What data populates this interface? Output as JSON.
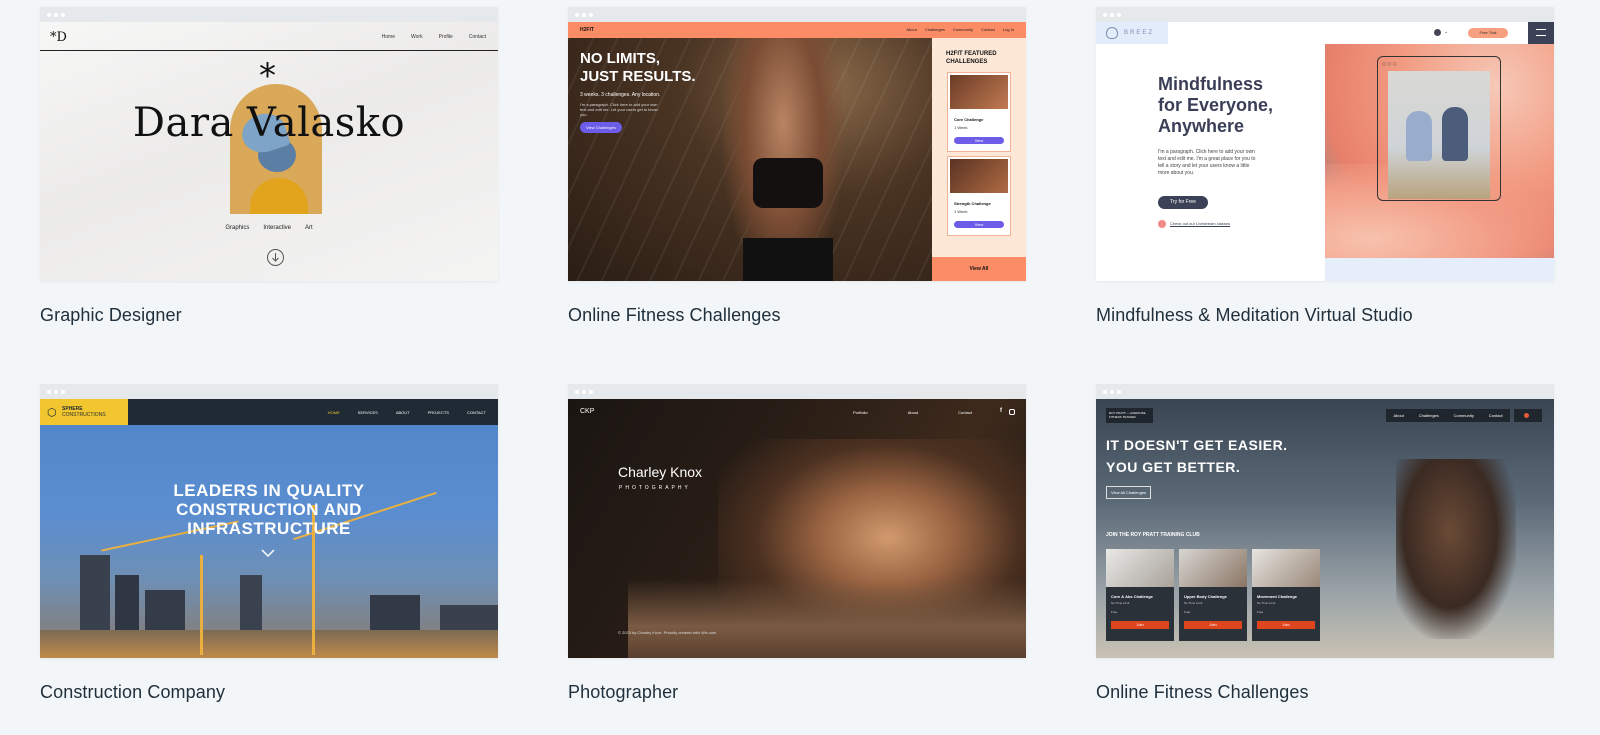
{
  "templates": [
    {
      "caption": "Graphic Designer",
      "logo": "*D",
      "nav": [
        "Home",
        "Work",
        "Profile",
        "Contact"
      ],
      "hero_title": "Dara Valasko",
      "asterisk": "*",
      "tags": [
        "Graphics",
        "Interactive",
        "Art"
      ]
    },
    {
      "caption": "Online Fitness Challenges",
      "logo": "H2FIT",
      "nav": [
        "About",
        "Challenges",
        "Community",
        "Contact",
        "Log In"
      ],
      "headline_1": "NO LIMITS,",
      "headline_2": "JUST RESULTS.",
      "subline": "3 weeks. 3 challenges. Any location.",
      "paragraph": "I'm a paragraph. Click here to add your own text and edit me. Let your users get to know you.",
      "cta": "View Challenges",
      "panel_title": "H2FIT FEATURED CHALLENGES",
      "items": [
        {
          "name": "Core Challenge",
          "duration": "1 Week",
          "button": "View"
        },
        {
          "name": "Strength Challenge",
          "duration": "1 Week",
          "button": "View"
        }
      ],
      "view_all": "View All"
    },
    {
      "caption": "Mindfulness & Meditation Virtual Studio",
      "logo": "BREEZ",
      "free_trial": "Free Trial",
      "heading": "Mindfulness for Everyone, Anywhere",
      "paragraph": "I'm a paragraph. Click here to add your own text and edit me. I'm a great place for you to tell a story and let your users know a little more about you.",
      "cta": "Try for Free",
      "link": "Check out our Livestream classes"
    },
    {
      "caption": "Construction Company",
      "logo_1": "SPHERE",
      "logo_2": "CONSTRUCTIONS",
      "nav": [
        "HOME",
        "SERVICES",
        "ABOUT",
        "PROJECTS",
        "CONTACT"
      ],
      "hero_1": "LEADERS IN QUALITY",
      "hero_2": "CONSTRUCTION AND",
      "hero_3": "INFRASTRUCTURE"
    },
    {
      "caption": "Photographer",
      "logo": "CKP",
      "nav": [
        "Portfolio",
        "About",
        "Contact"
      ],
      "name": "Charley Knox",
      "subtitle": "PHOTOGRAPHY",
      "footer": "© 2023 by Charley Knox. Proudly created with Wix.com"
    },
    {
      "caption": "Online Fitness Challenges",
      "logo": "ROY PRATT — EXERCISE FITNESS TRAINER",
      "nav": [
        "About",
        "Challenges",
        "Community",
        "Contact"
      ],
      "hero_1": "IT DOESN'T GET EASIER.",
      "hero_2": "YOU GET BETTER.",
      "cta": "View All Challenges",
      "club": "JOIN THE ROY PRATT TRAINING CLUB",
      "items": [
        {
          "name": "Core & Abs Challenge",
          "limit": "No Time Limit",
          "price": "Free",
          "button": "Join"
        },
        {
          "name": "Upper Body Challenge",
          "limit": "No Time Limit",
          "price": "Free",
          "button": "Join"
        },
        {
          "name": "Movement Challenge",
          "limit": "No Time Limit",
          "price": "Free",
          "button": "Join"
        }
      ]
    }
  ]
}
